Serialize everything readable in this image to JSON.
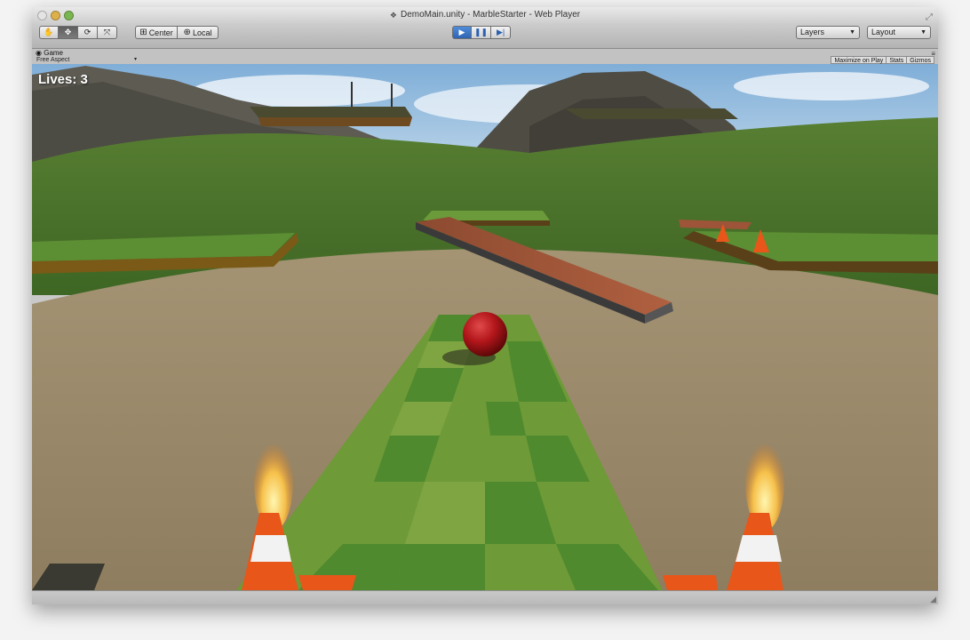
{
  "window": {
    "title": "DemoMain.unity - MarbleStarter - Web Player",
    "unity_icon": "unity-doc-icon"
  },
  "toolbar": {
    "transform_tools": [
      {
        "name": "hand-tool-icon",
        "glyph": "✋"
      },
      {
        "name": "move-tool-icon",
        "glyph": "✥"
      },
      {
        "name": "rotate-tool-icon",
        "glyph": "⟳"
      },
      {
        "name": "scale-tool-icon",
        "glyph": "⤧"
      }
    ],
    "pivot": {
      "center_label": "Center",
      "local_label": "Local"
    },
    "playback": {
      "play_glyph": "▶",
      "pause_glyph": "❚❚",
      "step_glyph": "▶|"
    },
    "layers_label": "Layers",
    "layout_label": "Layout"
  },
  "game_panel": {
    "tab_label": "Game",
    "aspect_label": "Free Aspect",
    "toggles": [
      "Maximize on Play",
      "Stats",
      "Gizmos"
    ]
  },
  "hud": {
    "lives_text": "Lives: 3"
  },
  "colors": {
    "play_active": "#3b78c8",
    "sky_top": "#7faed8",
    "grass_dark": "#3f7a2a",
    "grass_light": "#7ea541",
    "dirt": "#9a8a6a",
    "marble": "#b5151b",
    "plank": "#9e5438",
    "cone": "#e8561a"
  }
}
